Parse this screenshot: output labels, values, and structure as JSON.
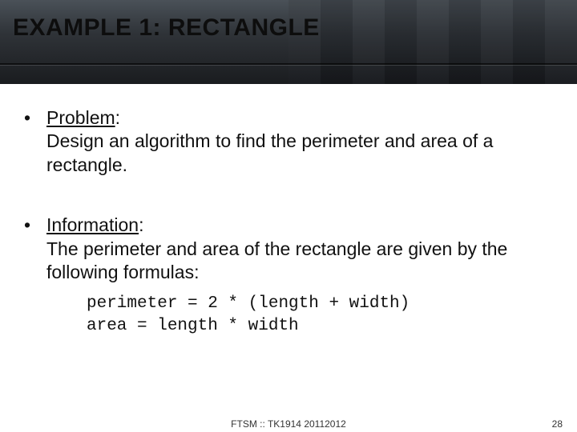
{
  "title": "EXAMPLE 1: RECTANGLE",
  "sections": [
    {
      "label": "Problem",
      "text": "Design an algorithm to find the perimeter and area of a rectangle."
    },
    {
      "label": "Information",
      "text": "The perimeter and area of the rectangle are given by the following formulas:"
    }
  ],
  "formulas": [
    "perimeter = 2 * (length + width)",
    "area = length * width"
  ],
  "footer": {
    "center": "FTSM :: TK1914 20112012",
    "page": "28"
  }
}
